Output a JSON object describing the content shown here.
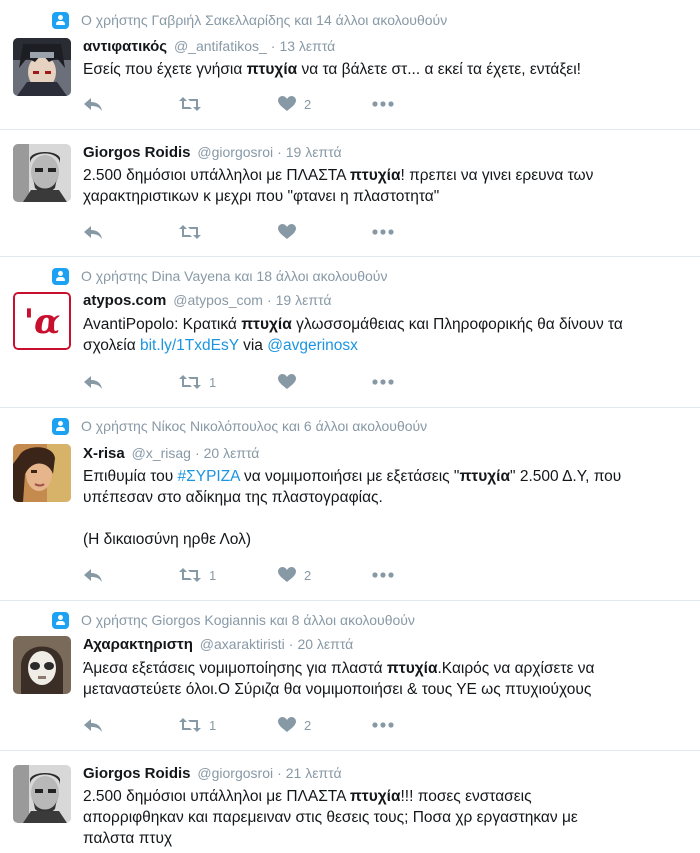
{
  "tweets": [
    {
      "context": "Ο χρήστης Γαβριήλ Σακελλαρίδης και 14 άλλοι ακολουθούν",
      "name": "αντιφατικός",
      "handle": "@_antifatikos_",
      "time": "13 λεπτά",
      "text": [
        {
          "t": "Εσείς που έχετε γνήσια "
        },
        {
          "t": "πτυχία",
          "kw": true
        },
        {
          "t": " να τα βάλετε στ... α εκεί τα έχετε, εντάξει!"
        }
      ],
      "retweets": "",
      "likes": "2"
    },
    {
      "context": "",
      "name": "Giorgos Roidis",
      "handle": "@giorgosroi",
      "time": "19 λεπτά",
      "text": [
        {
          "t": "2.500 δημόσιοι υπάλληλοι με ΠΛΑΣΤΑ "
        },
        {
          "t": "πτυχία",
          "kw": true
        },
        {
          "t": "! πρεπει να γινει ερευνα των\nχαρακτηριστικων κ μεχρι που \"φτανει η πλαστοτητα\""
        }
      ],
      "retweets": "",
      "likes": ""
    },
    {
      "context": "Ο χρήστης Dina Vayena και 18 άλλοι ακολουθούν",
      "name": "atypos.com",
      "handle": "@atypos_com",
      "time": "19 λεπτά",
      "text": [
        {
          "t": "AvantiPopolo: Κρατικά "
        },
        {
          "t": "πτυχία",
          "kw": true
        },
        {
          "t": " γλωσσομάθειας και Πληροφορικής θα δίνουν τα\nσχολεία "
        },
        {
          "t": "bit.ly/1TxdEsY",
          "link": true
        },
        {
          "t": " via "
        },
        {
          "t": "@avgerinosx",
          "link": true
        }
      ],
      "retweets": "1",
      "likes": "",
      "avatar_glyph": "'α"
    },
    {
      "context": "Ο χρήστης Νίκος Νικολόπουλος και 6 άλλοι ακολουθούν",
      "name": "X-risa",
      "handle": "@x_risag",
      "time": "20 λεπτά",
      "text": [
        {
          "t": "Επιθυμία του "
        },
        {
          "t": "#ΣΥΡΙΖΑ",
          "link": true
        },
        {
          "t": " να νομιμοποιήσει με εξετάσεις \""
        },
        {
          "t": "πτυχία",
          "kw": true
        },
        {
          "t": "\" 2.500 Δ.Υ, που\nυπέπεσαν στο αδίκημα της πλαστογραφίας.\n\n(Η δικαιοσύνη ηρθε Λολ)"
        }
      ],
      "retweets": "1",
      "likes": "2"
    },
    {
      "context": "Ο χρήστης Giorgos Kogiannis και 8 άλλοι ακολουθούν",
      "name": "Αχαρακτηριστη",
      "handle": "@axaraktiristi",
      "time": "20 λεπτά",
      "text": [
        {
          "t": "Άμεσα εξετάσεις νομιμοποίησης για πλαστά "
        },
        {
          "t": "πτυχία",
          "kw": true
        },
        {
          "t": ".Καιρός να αρχίσετε να\nμεταναστεύετε όλοι.Ο Σύριζα θα νομιμοποιήσει & τους ΥΕ ως πτυχιούχους"
        }
      ],
      "retweets": "1",
      "likes": "2"
    },
    {
      "context": "",
      "name": "Giorgos Roidis",
      "handle": "@giorgosroi",
      "time": "21 λεπτά",
      "text": [
        {
          "t": "2.500 δημόσιοι υπάλληλοι με ΠΛΑΣΤΑ "
        },
        {
          "t": "πτυχία",
          "kw": true
        },
        {
          "t": "!!! ποσες ενστασεις\nαπορριφθηκαν και παρεμειναν στις θεσεις τους; Ποσα χρ εργαστηκαν με\nπαλστα πτυχ"
        }
      ],
      "retweets": "",
      "likes": ""
    }
  ],
  "colors": {
    "link": "#1b95e0",
    "muted": "#8899a6",
    "divider": "#e1e8ed",
    "context_icon": "#1da1f2"
  },
  "icons": {
    "reply": "reply-icon",
    "retweet": "retweet-icon",
    "like": "heart-icon",
    "more": "more-icon",
    "context": "person-icon"
  }
}
